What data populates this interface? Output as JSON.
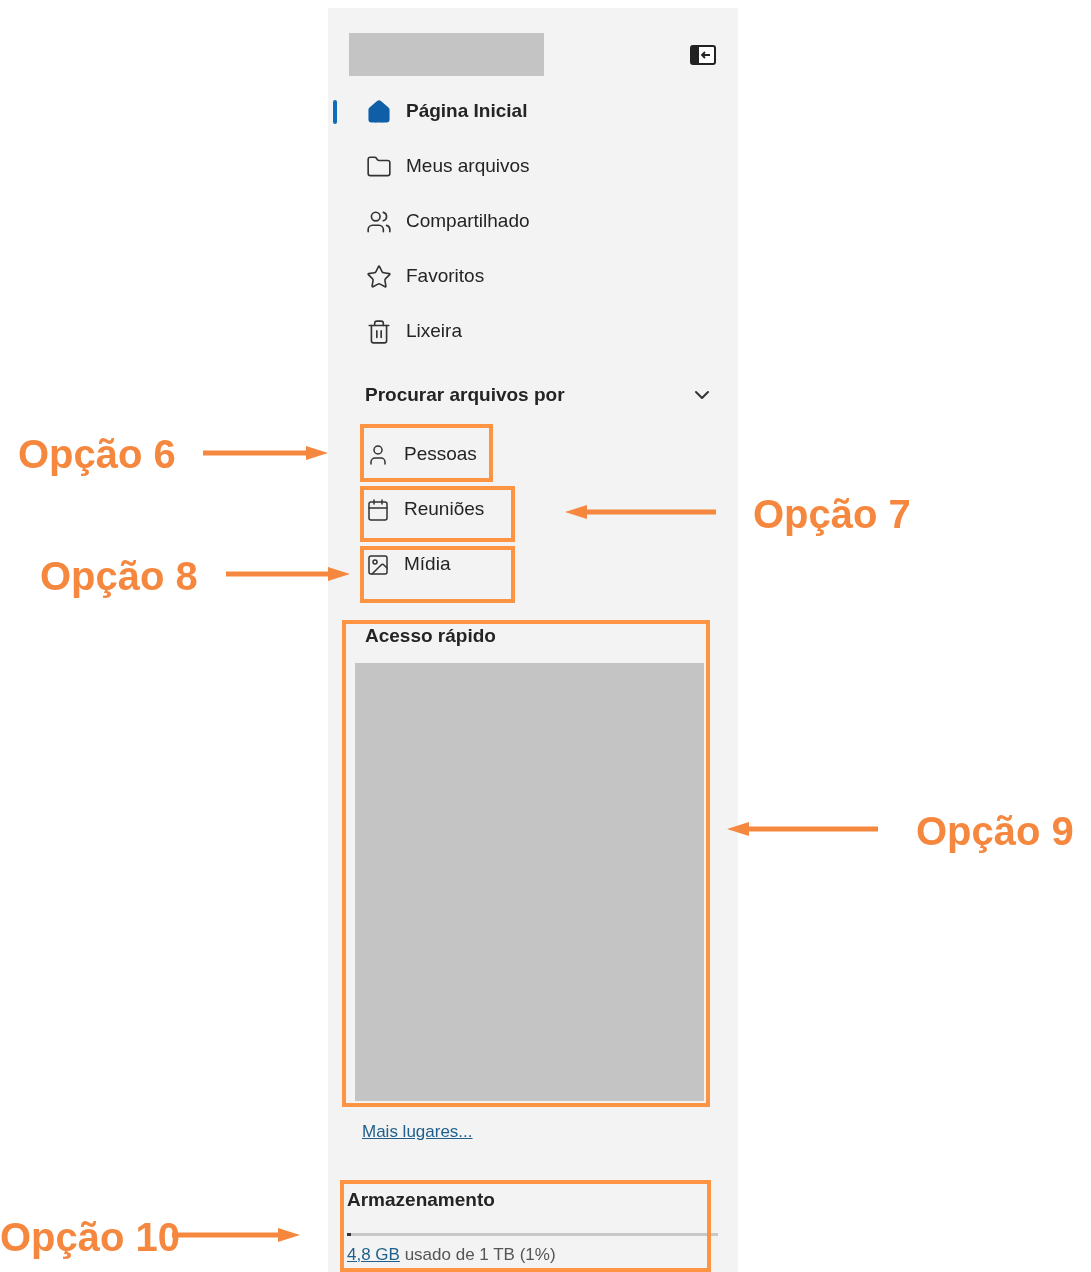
{
  "sidebar": {
    "nav_items": [
      {
        "label": "Página Inicial",
        "kind": "home",
        "selected": true
      },
      {
        "label": "Meus arquivos",
        "kind": "folder",
        "selected": false
      },
      {
        "label": "Compartilhado",
        "kind": "people",
        "selected": false
      },
      {
        "label": "Favoritos",
        "kind": "star",
        "selected": false
      },
      {
        "label": "Lixeira",
        "kind": "trash",
        "selected": false
      }
    ],
    "browse_section": {
      "title": "Procurar arquivos por",
      "expanded": true,
      "items": [
        {
          "label": "Pessoas",
          "kind": "person"
        },
        {
          "label": "Reuniões",
          "kind": "calendar"
        },
        {
          "label": "Mídia",
          "kind": "image"
        }
      ]
    },
    "quick_access": {
      "title": "Acesso rápido",
      "more_link": "Mais lugares..."
    },
    "storage": {
      "title": "Armazenamento",
      "level": 0.01,
      "used_link": "4,8 GB",
      "detail": "usado de 1 TB (1%)"
    }
  },
  "annotations": [
    {
      "label": "Opção 6"
    },
    {
      "label": "Opção 7"
    },
    {
      "label": "Opção 8"
    },
    {
      "label": "Opção 9"
    },
    {
      "label": "Opção 10"
    }
  ]
}
